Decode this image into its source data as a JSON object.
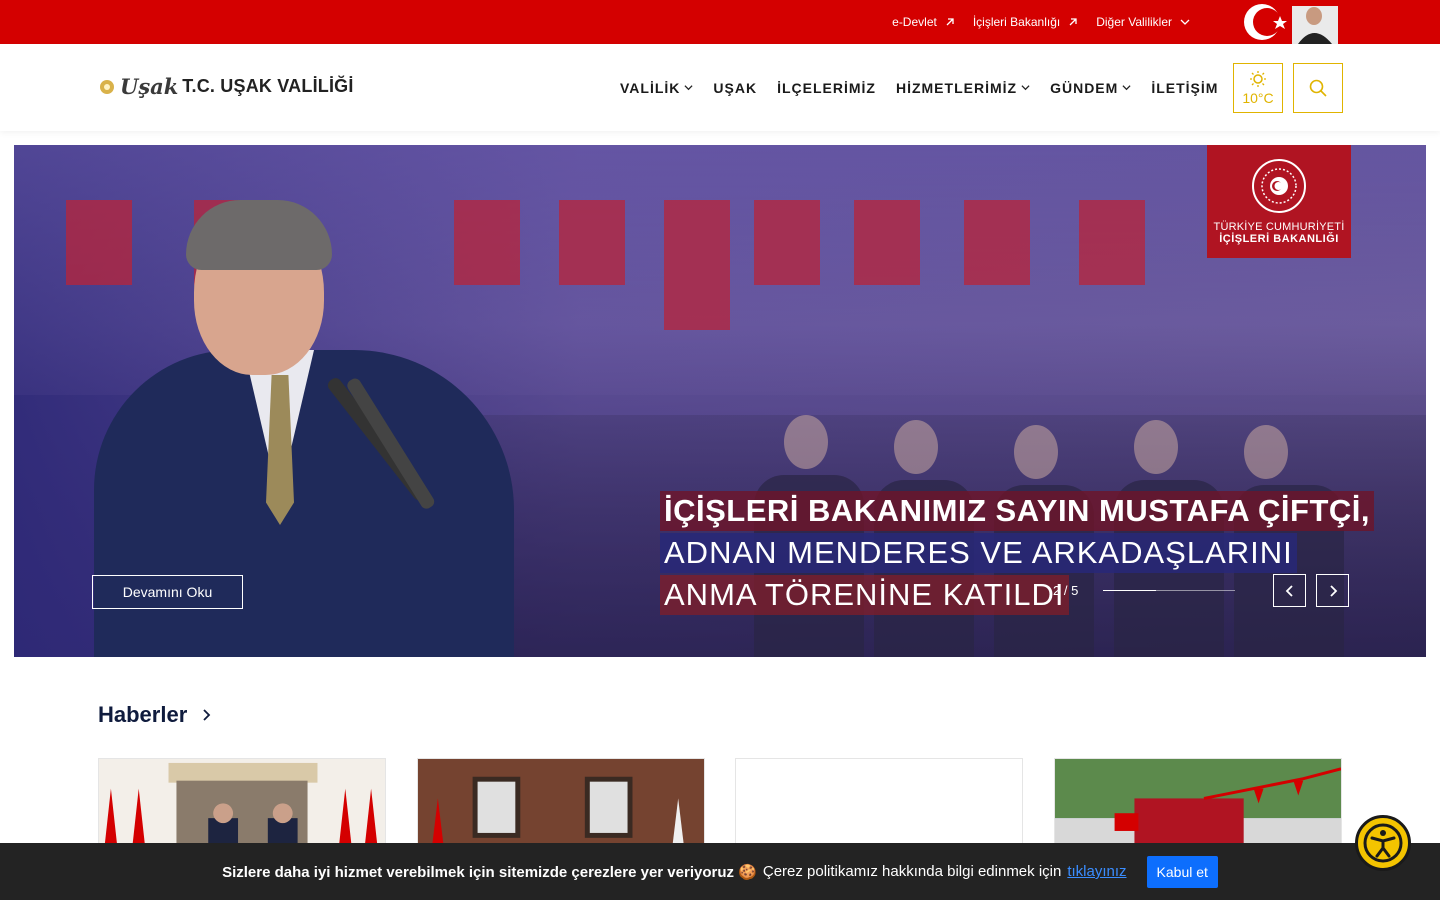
{
  "topbar": {
    "links": [
      {
        "label": "e-Devlet",
        "icon": "external-link-icon"
      },
      {
        "label": "İçişleri Bakanlığı",
        "icon": "external-link-icon"
      },
      {
        "label": "Diğer Valilikler",
        "icon": "chevron-down-icon"
      }
    ],
    "color": "#d40000"
  },
  "header": {
    "brand_script": "Uşak",
    "brand_title": "T.C. UŞAK VALİLİĞİ",
    "nav": [
      {
        "label": "VALİLİK",
        "has_dropdown": true
      },
      {
        "label": "UŞAK",
        "has_dropdown": false
      },
      {
        "label": "İLÇELERİMİZ",
        "has_dropdown": false
      },
      {
        "label": "HİZMETLERİMİZ",
        "has_dropdown": true
      },
      {
        "label": "GÜNDEM",
        "has_dropdown": true
      },
      {
        "label": "İLETİŞİM",
        "has_dropdown": false
      }
    ],
    "weather": {
      "temp": "10°C",
      "icon": "sun-icon"
    },
    "search_icon": "search-icon",
    "accent": "#e0b400"
  },
  "hero": {
    "ministry_line1": "TÜRKİYE CUMHURİYETİ",
    "ministry_line2": "İÇİŞLERİ BAKANLIĞI",
    "caption": [
      "İÇİŞLERİ BAKANIMIZ SAYIN MUSTAFA ÇİFTÇİ,",
      "ADNAN MENDERES VE ARKADAŞLARINI",
      "ANMA TÖRENİNE KATILDI"
    ],
    "read_more": "Devamını Oku",
    "counter": "2 / 5",
    "progress": 0.4
  },
  "news": {
    "title": "Haberler"
  },
  "cookie": {
    "strong": "Sizlere daha iyi hizmet verebilmek için sitemizde çerezlere yer veriyoruz 🍪",
    "normal": "Çerez politikamız hakkında bilgi edinmek için",
    "link": "tıklayınız",
    "accept": "Kabul et"
  }
}
